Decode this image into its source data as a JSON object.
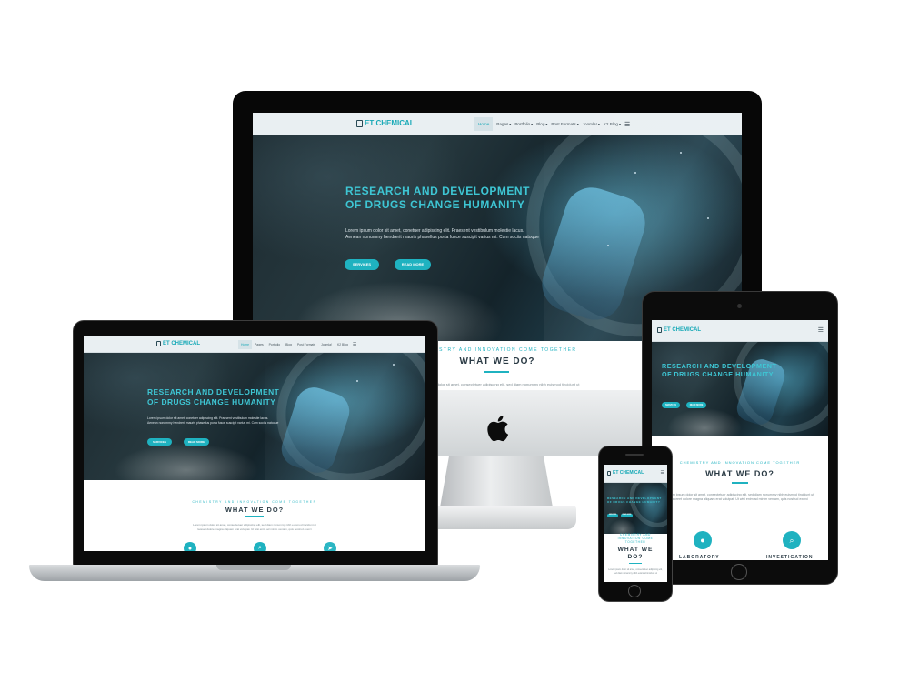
{
  "site": {
    "logo": "ET CHEMICAL",
    "menu": [
      "Home",
      "Pages",
      "Portfolio",
      "Blog",
      "Post Formats",
      "Joomla!",
      "K2 Blog"
    ],
    "hero_title_1": "RESEARCH AND DEVELOPMENT",
    "hero_title_2": "OF DRUGS CHANGE HUMANITY",
    "hero_text_1": "Lorem ipsum dolor sit amet, conetuer adipiscing elit. Praesent vestibulum molestie lacus.",
    "hero_text_2": "Aenean nonummy hendrerit mauris phasellus porta fusce suscipit varius mi. Cum sociis natoque",
    "btn_1": "SERVICES",
    "btn_2": "READ MORE",
    "section_sub": "CHEMISTRY AND INNOVATION COME TOGETHER",
    "section_title": "WHAT WE DO?",
    "section_text_1": "Lorem ipsum dolor sit amet, consectetuer adipiscing elit, sed diam nonummy nibh euismod tincidunt ut",
    "section_text_2": "laoreet dolore magna aliquam erat volutpat. Ut wisi enim ad minim veniam, quis nostrud exerci",
    "feature_1": "LABORATORY",
    "feature_2": "INVESTIGATION"
  },
  "colors": {
    "accent": "#1fb2c0",
    "nav_bg": "#e9eff2",
    "title": "#3ec6d4"
  },
  "icons": [
    "flask-icon",
    "hamburger-menu-icon",
    "chevron-down-icon",
    "search-icon",
    "user-icon",
    "send-icon",
    "apple-logo-icon"
  ]
}
